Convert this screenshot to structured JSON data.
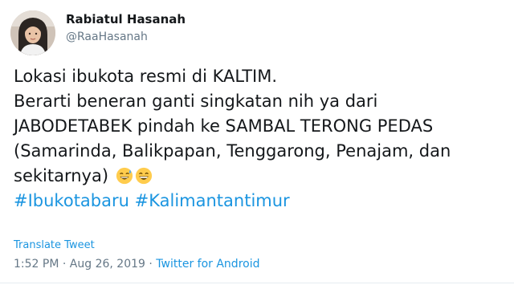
{
  "author": {
    "display_name": "Rabiatul Hasanah",
    "handle": "@RaaHasanah"
  },
  "tweet": {
    "lines": [
      "Lokasi ibukota resmi di KALTIM.",
      "Berarti beneran ganti singkatan nih ya dari",
      "JABODETABEK pindah ke SAMBAL TERONG PEDAS",
      "(Samarinda, Balikpapan, Tenggarong, Penajam, dan",
      "sekitarnya)"
    ],
    "emojis": [
      "sweat-smile-emoji",
      "grinning-emoji"
    ],
    "hashtags": [
      "#Ibukotabaru",
      "#Kalimantantimur"
    ]
  },
  "translate_label": "Translate Tweet",
  "meta": {
    "time": "1:52 PM",
    "separator": "·",
    "date": "Aug 26, 2019",
    "source": "Twitter for Android"
  },
  "colors": {
    "link": "#1b95e0",
    "secondary_text": "#657786",
    "text": "#14171a"
  }
}
